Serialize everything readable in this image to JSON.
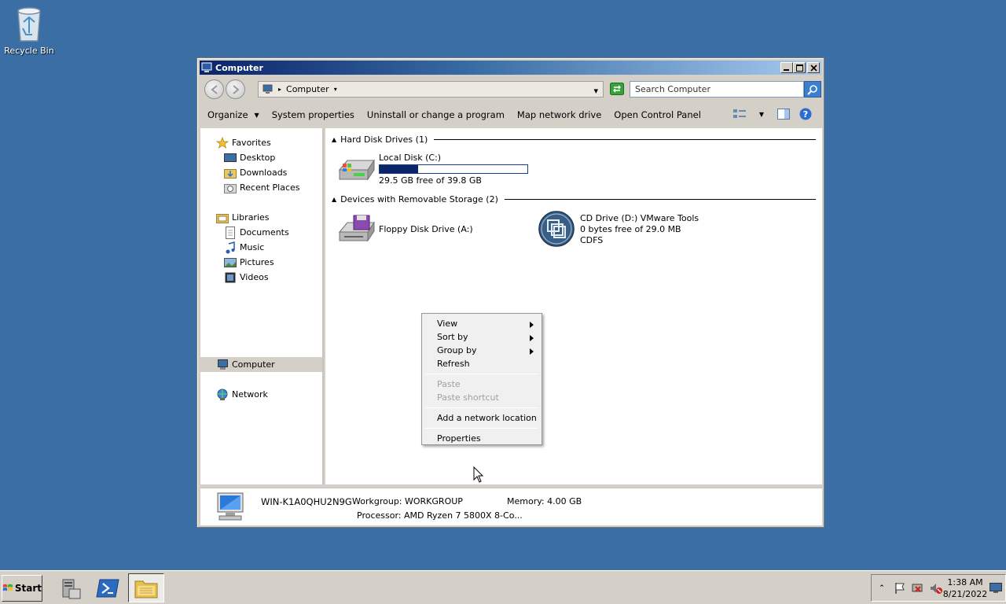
{
  "desktop": {
    "recycle_bin_label": "Recycle Bin"
  },
  "window": {
    "title": "Computer",
    "address": {
      "crumb": "Computer"
    },
    "search": {
      "placeholder": "Search Computer"
    },
    "toolbar": {
      "organize": "Organize",
      "system_properties": "System properties",
      "uninstall": "Uninstall or change a program",
      "map_drive": "Map network drive",
      "control_panel": "Open Control Panel"
    },
    "nav": {
      "favorites": "Favorites",
      "desktop": "Desktop",
      "downloads": "Downloads",
      "recent_places": "Recent Places",
      "libraries": "Libraries",
      "documents": "Documents",
      "music": "Music",
      "pictures": "Pictures",
      "videos": "Videos",
      "computer": "Computer",
      "network": "Network"
    },
    "groups": {
      "hdd_header": "Hard Disk Drives (1)",
      "removable_header": "Devices with Removable Storage (2)"
    },
    "drives": {
      "local_disk": {
        "name": "Local Disk (C:)",
        "free_text": "29.5 GB free of 39.8 GB",
        "used_fraction": 0.26
      },
      "floppy": {
        "name": "Floppy Disk Drive (A:)"
      },
      "cd": {
        "name": "CD Drive (D:) VMware Tools",
        "free_text": "0 bytes free of 29.0 MB",
        "fs": "CDFS"
      }
    },
    "details": {
      "computer_name": "WIN-K1A0QHU2N9G",
      "workgroup": "Workgroup: WORKGROUP",
      "memory": "Memory: 4.00 GB",
      "processor": "Processor: AMD Ryzen 7 5800X 8-Co..."
    }
  },
  "context_menu": {
    "view": "View",
    "sort_by": "Sort by",
    "group_by": "Group by",
    "refresh": "Refresh",
    "paste": "Paste",
    "paste_shortcut": "Paste shortcut",
    "add_network_location": "Add a network location",
    "properties": "Properties"
  },
  "taskbar": {
    "start": "Start",
    "time": "1:38 AM",
    "date": "8/21/2022"
  },
  "colors": {
    "desktop": "#3a6ea5",
    "title_start": "#0a246a",
    "bar_fill": "#0a246a"
  }
}
